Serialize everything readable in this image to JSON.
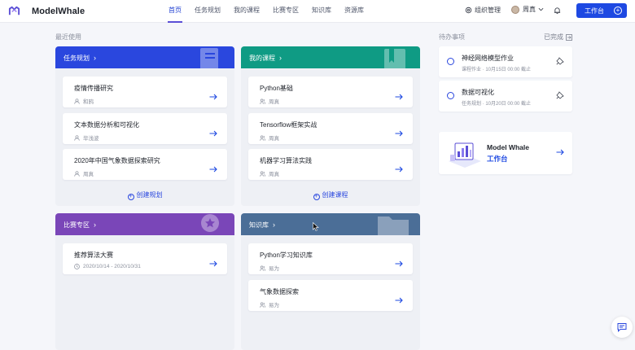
{
  "app": {
    "name": "ModelWhale"
  },
  "nav": {
    "items": [
      {
        "label": "首页",
        "active": true
      },
      {
        "label": "任务规划",
        "active": false
      },
      {
        "label": "我的课程",
        "active": false
      },
      {
        "label": "比赛专区",
        "active": false
      },
      {
        "label": "知识库",
        "active": false
      },
      {
        "label": "资源库",
        "active": false
      }
    ],
    "org_label": "组织管理",
    "user_name": "周真",
    "workbench_label": "工作台"
  },
  "recent": {
    "title": "最近使用"
  },
  "panels": {
    "tasks": {
      "title": "任务规划",
      "items": [
        {
          "title": "疫情传播研究",
          "meta": "和鸦"
        },
        {
          "title": "文本数据分析和可视化",
          "meta": "毕浅波"
        },
        {
          "title": "2020年中国气象数据探索研究",
          "meta": "周真"
        }
      ],
      "create_label": "创建规划"
    },
    "courses": {
      "title": "我的课程",
      "items": [
        {
          "title": "Python基础",
          "meta": "周真"
        },
        {
          "title": "Tensorflow框架实战",
          "meta": "周真"
        },
        {
          "title": "机器学习算法实践",
          "meta": "周真"
        }
      ],
      "create_label": "创建课程"
    },
    "competitions": {
      "title": "比赛专区",
      "items": [
        {
          "title": "推荐算法大赛",
          "meta": "2020/10/14 - 2020/10/31"
        }
      ]
    },
    "knowledge": {
      "title": "知识库",
      "items": [
        {
          "title": "Python学习知识库",
          "meta": "易为"
        },
        {
          "title": "气象数据探索",
          "meta": "易为"
        }
      ]
    }
  },
  "todos": {
    "title": "待办事项",
    "done_label": "已完成",
    "items": [
      {
        "title": "神经网络模型作业",
        "meta": "课程作业 · 10月15日 00:00 截止"
      },
      {
        "title": "数据可视化",
        "meta": "任务规划 · 10月20日 00:00 截止"
      }
    ]
  },
  "workbench_card": {
    "line1": "Model Whale",
    "line2": "工作台"
  },
  "colors": {
    "primary": "#1e49e2",
    "tasks_head": "#2a47de",
    "courses_head": "#0f9b84",
    "competitions_head": "#7a46b8",
    "knowledge_head": "#4b6e97",
    "background": "#f5f6fa"
  },
  "icons": [
    "logo-icon",
    "settings-icon",
    "avatar",
    "chevron-down-icon",
    "bell-icon",
    "plus-circle-icon",
    "user-icon",
    "arrow-right-icon",
    "clock-icon",
    "pin-icon",
    "exit-icon",
    "chat-icon"
  ]
}
